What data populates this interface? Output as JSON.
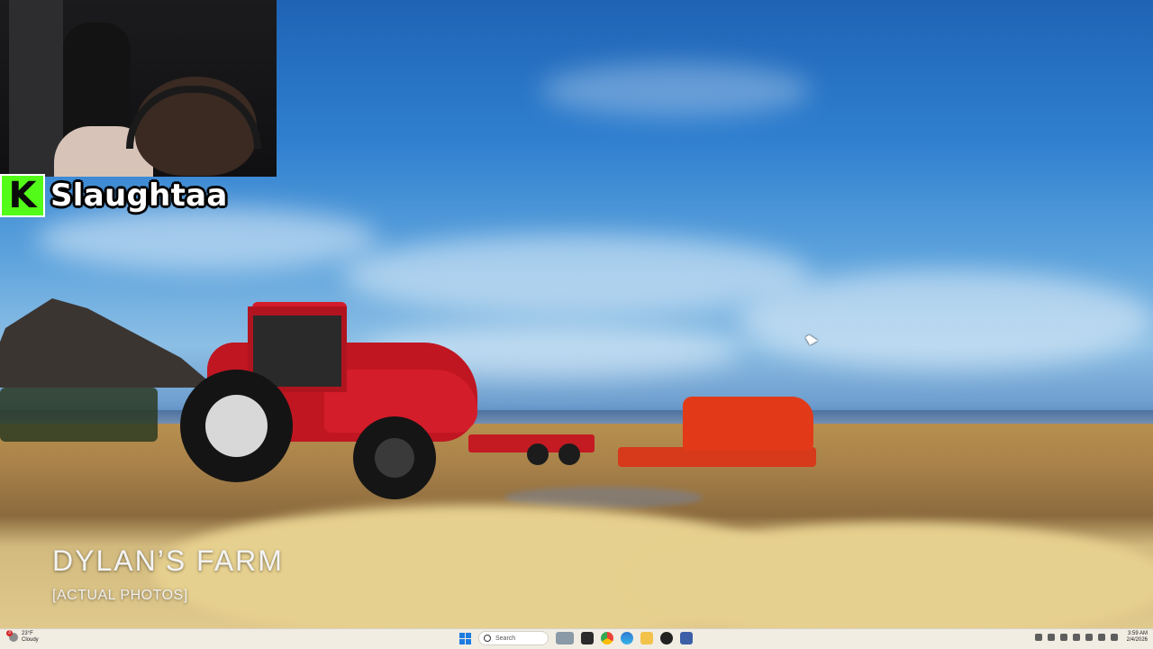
{
  "stream": {
    "streamer_name": "Slaughtaa",
    "platform_icon_letter": "K"
  },
  "overlay": {
    "title": "DYLAN’S FARM",
    "subtitle": "[ACTUAL PHOTOS]"
  },
  "taskbar": {
    "weather": {
      "temp": "23°F",
      "condition": "Cloudy",
      "badge": "3"
    },
    "search_placeholder": "Search",
    "clock": {
      "time": "3:59 AM",
      "date": "2/4/2026"
    },
    "pinned_icons": [
      "start-icon",
      "search",
      "task-view-icon",
      "app-icon",
      "chrome-icon",
      "file-explorer-icon",
      "edge-icon",
      "app-icon-2",
      "app-icon-3"
    ]
  },
  "colors": {
    "kick_green": "#53fc18",
    "taskbar_bg": "#f1ede3",
    "windows_blue": "#1e7be0"
  }
}
